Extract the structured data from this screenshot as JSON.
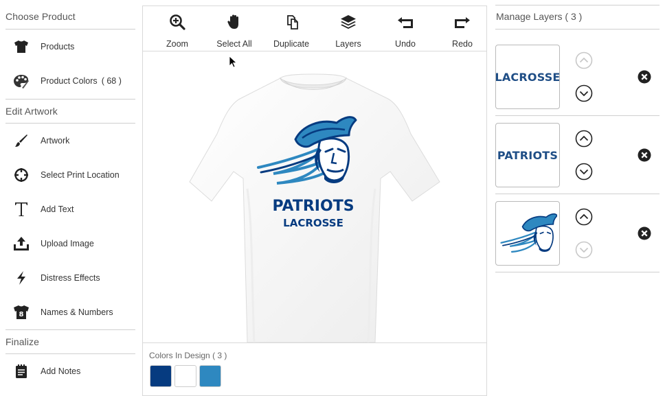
{
  "sidebar": {
    "choose_product": {
      "title": "Choose Product",
      "items": [
        {
          "label": "Products",
          "icon": "tshirt-icon"
        },
        {
          "label": "Product Colors",
          "count": "( 68 )",
          "icon": "palette-icon"
        }
      ]
    },
    "edit_artwork": {
      "title": "Edit Artwork",
      "items": [
        {
          "label": "Artwork",
          "icon": "brush-icon"
        },
        {
          "label": "Select Print Location",
          "icon": "crosshair-icon"
        },
        {
          "label": "Add Text",
          "icon": "text-icon"
        },
        {
          "label": "Upload Image",
          "icon": "upload-icon"
        },
        {
          "label": "Distress Effects",
          "icon": "lightning-icon"
        },
        {
          "label": "Names & Numbers",
          "icon": "jersey-number-icon"
        }
      ]
    },
    "finalize": {
      "title": "Finalize",
      "items": [
        {
          "label": "Add Notes",
          "icon": "notepad-icon"
        }
      ]
    }
  },
  "toolbar": {
    "items": [
      {
        "label": "Zoom",
        "icon": "zoom-in-icon"
      },
      {
        "label": "Select All",
        "icon": "hand-icon"
      },
      {
        "label": "Duplicate",
        "icon": "duplicate-icon"
      },
      {
        "label": "Layers",
        "icon": "layers-icon"
      },
      {
        "label": "Undo",
        "icon": "undo-icon"
      },
      {
        "label": "Redo",
        "icon": "redo-icon"
      }
    ]
  },
  "canvas": {
    "design_text_1": "PATRIOTS",
    "design_text_2": "LACROSSE"
  },
  "colors_in_design": {
    "title": "Colors In Design",
    "count": "( 3 )",
    "swatches": [
      "#063b80",
      "#ffffff",
      "#2e88c0"
    ]
  },
  "layers": {
    "title": "Manage Layers",
    "count": "( 3 )",
    "items": [
      {
        "type": "text",
        "text": "LACROSSE",
        "up_enabled": false,
        "down_enabled": true
      },
      {
        "type": "text",
        "text": "PATRIOTS",
        "up_enabled": true,
        "down_enabled": true
      },
      {
        "type": "image",
        "icon": "patriot-mascot-icon",
        "up_enabled": true,
        "down_enabled": false
      }
    ]
  },
  "colors": {
    "navy": "#063b80",
    "blue": "#2e88c0",
    "text": "#333333",
    "divider": "#cfcfcf"
  }
}
